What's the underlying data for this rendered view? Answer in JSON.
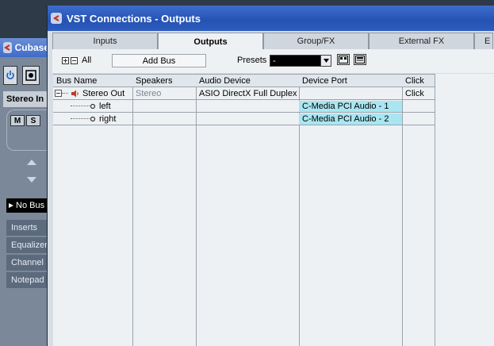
{
  "background_window": {
    "title": "Cubase",
    "channel_name": "Stereo In",
    "mute_label": "M",
    "solo_label": "S",
    "routing_label": "No Bus",
    "sections": [
      "Inserts",
      "Equalizers",
      "Channel",
      "Notepad"
    ],
    "icons": [
      "cubase-logo-icon",
      "power-icon",
      "record-icon",
      "arrow-up-icon",
      "arrow-down-icon",
      "arrow-right-icon"
    ]
  },
  "window": {
    "title": "VST Connections - Outputs",
    "icon": "cubase-logo-icon"
  },
  "tabs": [
    {
      "label": "Inputs",
      "active": false
    },
    {
      "label": "Outputs",
      "active": true
    },
    {
      "label": "Group/FX",
      "active": false
    },
    {
      "label": "External FX",
      "active": false
    },
    {
      "label": "E",
      "active": false
    }
  ],
  "toolbar": {
    "all_label": "All",
    "add_bus_label": "Add Bus",
    "presets_label": "Presets",
    "presets_value": "-",
    "icons": [
      "expand-all-icon",
      "collapse-all-icon",
      "dropdown-arrow-icon",
      "save-preset-icon",
      "delete-preset-icon"
    ]
  },
  "table": {
    "columns": [
      "Bus Name",
      "Speakers",
      "Audio Device",
      "Device Port",
      "Click"
    ],
    "bus": {
      "name": "Stereo Out",
      "speakers": "Stereo",
      "audio_device": "ASIO DirectX Full Duplex Driver",
      "device_port": "",
      "click": "Click"
    },
    "channels": [
      {
        "name": "left",
        "device_port": "C-Media PCI Audio - 1"
      },
      {
        "name": "right",
        "device_port": "C-Media PCI Audio - 2"
      }
    ]
  },
  "colors": {
    "title_bar": "#2553b4",
    "port_highlight": "#a9e6f1",
    "panel": "#eef1f4",
    "backdrop": "#2e3a48"
  }
}
